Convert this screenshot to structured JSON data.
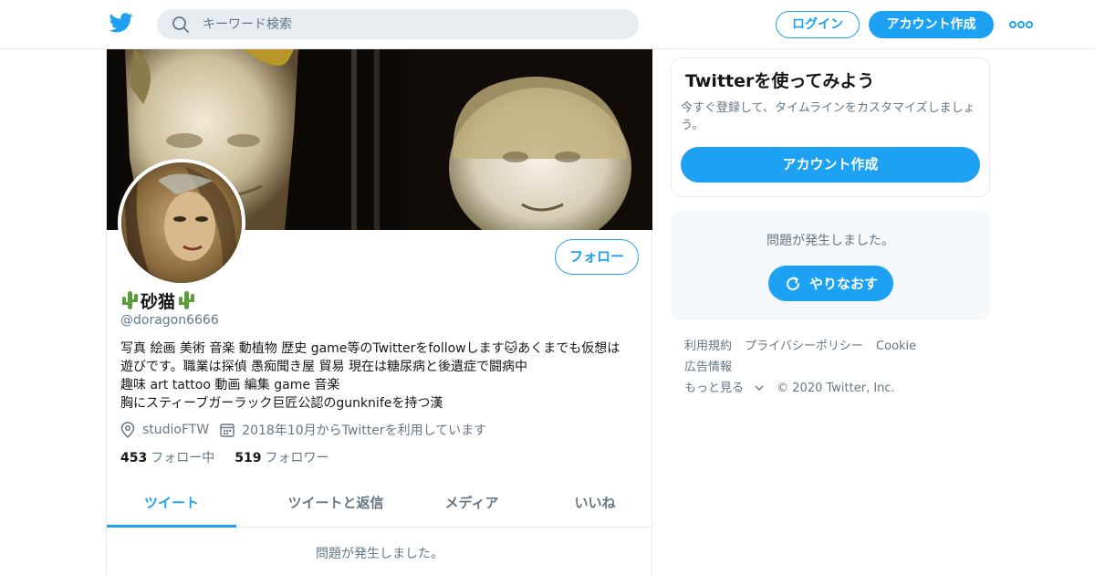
{
  "header": {
    "search_placeholder": "キーワード検索",
    "login_label": "ログイン",
    "signup_label": "アカウント作成",
    "brand_color": "#1da1f2"
  },
  "profile": {
    "display_name": "砂猫",
    "handle": "@doragon6666",
    "bio_lines": [
      "写真 絵画 美術 音楽 動植物 歴史 game等のTwitterをfollowします🐱あくまでも仮想は",
      "遊びです。職業は探偵 愚痴聞き屋 貿易 現在は糖尿病と後遺症で闘病中",
      "趣味 art tattoo 動画 編集 game 音楽",
      "胸にスティーブガーラック巨匠公認のgunknifeを持つ漢"
    ],
    "location": "studioFTW",
    "joined": "2018年10月からTwitterを利用しています",
    "following_count": "453",
    "following_label": "フォロー中",
    "followers_count": "519",
    "followers_label": "フォロワー",
    "follow_button": "フォロー"
  },
  "tabs": [
    "ツイート",
    "ツイートと返信",
    "メディア",
    "いいね"
  ],
  "timeline_error": "問題が発生しました。",
  "signup_card": {
    "title": "Twitterを使ってみよう",
    "description": "今すぐ登録して、タイムラインをカスタマイズしましょう。",
    "button": "アカウント作成"
  },
  "error_card": {
    "message": "問題が発生しました。",
    "retry_label": "やりなおす"
  },
  "footer": {
    "links": [
      "利用規約",
      "プライバシーポリシー",
      "Cookie",
      "広告情報"
    ],
    "more_label": "もっと見る",
    "copyright": "© 2020 Twitter, Inc."
  }
}
